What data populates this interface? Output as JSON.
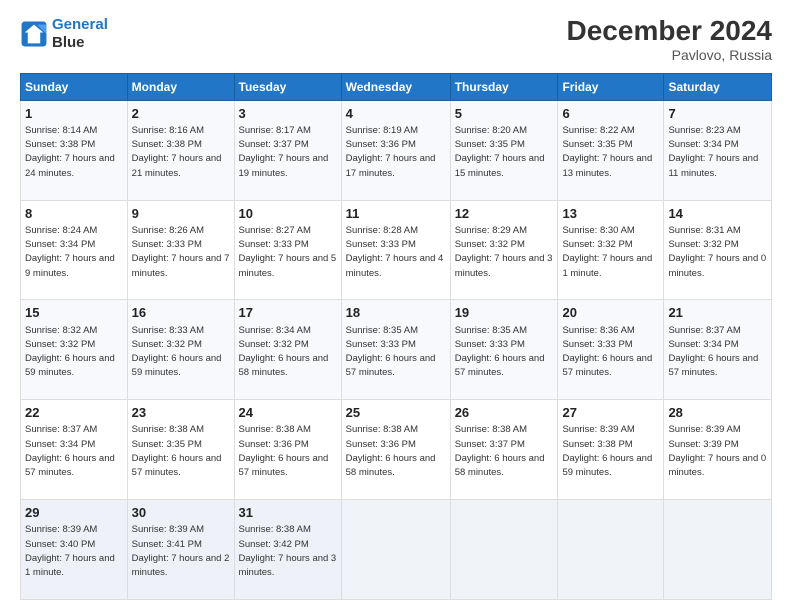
{
  "logo": {
    "line1": "General",
    "line2": "Blue"
  },
  "title": "December 2024",
  "subtitle": "Pavlovo, Russia",
  "days_of_week": [
    "Sunday",
    "Monday",
    "Tuesday",
    "Wednesday",
    "Thursday",
    "Friday",
    "Saturday"
  ],
  "weeks": [
    [
      {
        "day": "1",
        "sunrise": "Sunrise: 8:14 AM",
        "sunset": "Sunset: 3:38 PM",
        "daylight": "Daylight: 7 hours and 24 minutes."
      },
      {
        "day": "2",
        "sunrise": "Sunrise: 8:16 AM",
        "sunset": "Sunset: 3:38 PM",
        "daylight": "Daylight: 7 hours and 21 minutes."
      },
      {
        "day": "3",
        "sunrise": "Sunrise: 8:17 AM",
        "sunset": "Sunset: 3:37 PM",
        "daylight": "Daylight: 7 hours and 19 minutes."
      },
      {
        "day": "4",
        "sunrise": "Sunrise: 8:19 AM",
        "sunset": "Sunset: 3:36 PM",
        "daylight": "Daylight: 7 hours and 17 minutes."
      },
      {
        "day": "5",
        "sunrise": "Sunrise: 8:20 AM",
        "sunset": "Sunset: 3:35 PM",
        "daylight": "Daylight: 7 hours and 15 minutes."
      },
      {
        "day": "6",
        "sunrise": "Sunrise: 8:22 AM",
        "sunset": "Sunset: 3:35 PM",
        "daylight": "Daylight: 7 hours and 13 minutes."
      },
      {
        "day": "7",
        "sunrise": "Sunrise: 8:23 AM",
        "sunset": "Sunset: 3:34 PM",
        "daylight": "Daylight: 7 hours and 11 minutes."
      }
    ],
    [
      {
        "day": "8",
        "sunrise": "Sunrise: 8:24 AM",
        "sunset": "Sunset: 3:34 PM",
        "daylight": "Daylight: 7 hours and 9 minutes."
      },
      {
        "day": "9",
        "sunrise": "Sunrise: 8:26 AM",
        "sunset": "Sunset: 3:33 PM",
        "daylight": "Daylight: 7 hours and 7 minutes."
      },
      {
        "day": "10",
        "sunrise": "Sunrise: 8:27 AM",
        "sunset": "Sunset: 3:33 PM",
        "daylight": "Daylight: 7 hours and 5 minutes."
      },
      {
        "day": "11",
        "sunrise": "Sunrise: 8:28 AM",
        "sunset": "Sunset: 3:33 PM",
        "daylight": "Daylight: 7 hours and 4 minutes."
      },
      {
        "day": "12",
        "sunrise": "Sunrise: 8:29 AM",
        "sunset": "Sunset: 3:32 PM",
        "daylight": "Daylight: 7 hours and 3 minutes."
      },
      {
        "day": "13",
        "sunrise": "Sunrise: 8:30 AM",
        "sunset": "Sunset: 3:32 PM",
        "daylight": "Daylight: 7 hours and 1 minute."
      },
      {
        "day": "14",
        "sunrise": "Sunrise: 8:31 AM",
        "sunset": "Sunset: 3:32 PM",
        "daylight": "Daylight: 7 hours and 0 minutes."
      }
    ],
    [
      {
        "day": "15",
        "sunrise": "Sunrise: 8:32 AM",
        "sunset": "Sunset: 3:32 PM",
        "daylight": "Daylight: 6 hours and 59 minutes."
      },
      {
        "day": "16",
        "sunrise": "Sunrise: 8:33 AM",
        "sunset": "Sunset: 3:32 PM",
        "daylight": "Daylight: 6 hours and 59 minutes."
      },
      {
        "day": "17",
        "sunrise": "Sunrise: 8:34 AM",
        "sunset": "Sunset: 3:32 PM",
        "daylight": "Daylight: 6 hours and 58 minutes."
      },
      {
        "day": "18",
        "sunrise": "Sunrise: 8:35 AM",
        "sunset": "Sunset: 3:33 PM",
        "daylight": "Daylight: 6 hours and 57 minutes."
      },
      {
        "day": "19",
        "sunrise": "Sunrise: 8:35 AM",
        "sunset": "Sunset: 3:33 PM",
        "daylight": "Daylight: 6 hours and 57 minutes."
      },
      {
        "day": "20",
        "sunrise": "Sunrise: 8:36 AM",
        "sunset": "Sunset: 3:33 PM",
        "daylight": "Daylight: 6 hours and 57 minutes."
      },
      {
        "day": "21",
        "sunrise": "Sunrise: 8:37 AM",
        "sunset": "Sunset: 3:34 PM",
        "daylight": "Daylight: 6 hours and 57 minutes."
      }
    ],
    [
      {
        "day": "22",
        "sunrise": "Sunrise: 8:37 AM",
        "sunset": "Sunset: 3:34 PM",
        "daylight": "Daylight: 6 hours and 57 minutes."
      },
      {
        "day": "23",
        "sunrise": "Sunrise: 8:38 AM",
        "sunset": "Sunset: 3:35 PM",
        "daylight": "Daylight: 6 hours and 57 minutes."
      },
      {
        "day": "24",
        "sunrise": "Sunrise: 8:38 AM",
        "sunset": "Sunset: 3:36 PM",
        "daylight": "Daylight: 6 hours and 57 minutes."
      },
      {
        "day": "25",
        "sunrise": "Sunrise: 8:38 AM",
        "sunset": "Sunset: 3:36 PM",
        "daylight": "Daylight: 6 hours and 58 minutes."
      },
      {
        "day": "26",
        "sunrise": "Sunrise: 8:38 AM",
        "sunset": "Sunset: 3:37 PM",
        "daylight": "Daylight: 6 hours and 58 minutes."
      },
      {
        "day": "27",
        "sunrise": "Sunrise: 8:39 AM",
        "sunset": "Sunset: 3:38 PM",
        "daylight": "Daylight: 6 hours and 59 minutes."
      },
      {
        "day": "28",
        "sunrise": "Sunrise: 8:39 AM",
        "sunset": "Sunset: 3:39 PM",
        "daylight": "Daylight: 7 hours and 0 minutes."
      }
    ],
    [
      {
        "day": "29",
        "sunrise": "Sunrise: 8:39 AM",
        "sunset": "Sunset: 3:40 PM",
        "daylight": "Daylight: 7 hours and 1 minute."
      },
      {
        "day": "30",
        "sunrise": "Sunrise: 8:39 AM",
        "sunset": "Sunset: 3:41 PM",
        "daylight": "Daylight: 7 hours and 2 minutes."
      },
      {
        "day": "31",
        "sunrise": "Sunrise: 8:38 AM",
        "sunset": "Sunset: 3:42 PM",
        "daylight": "Daylight: 7 hours and 3 minutes."
      },
      null,
      null,
      null,
      null
    ]
  ]
}
